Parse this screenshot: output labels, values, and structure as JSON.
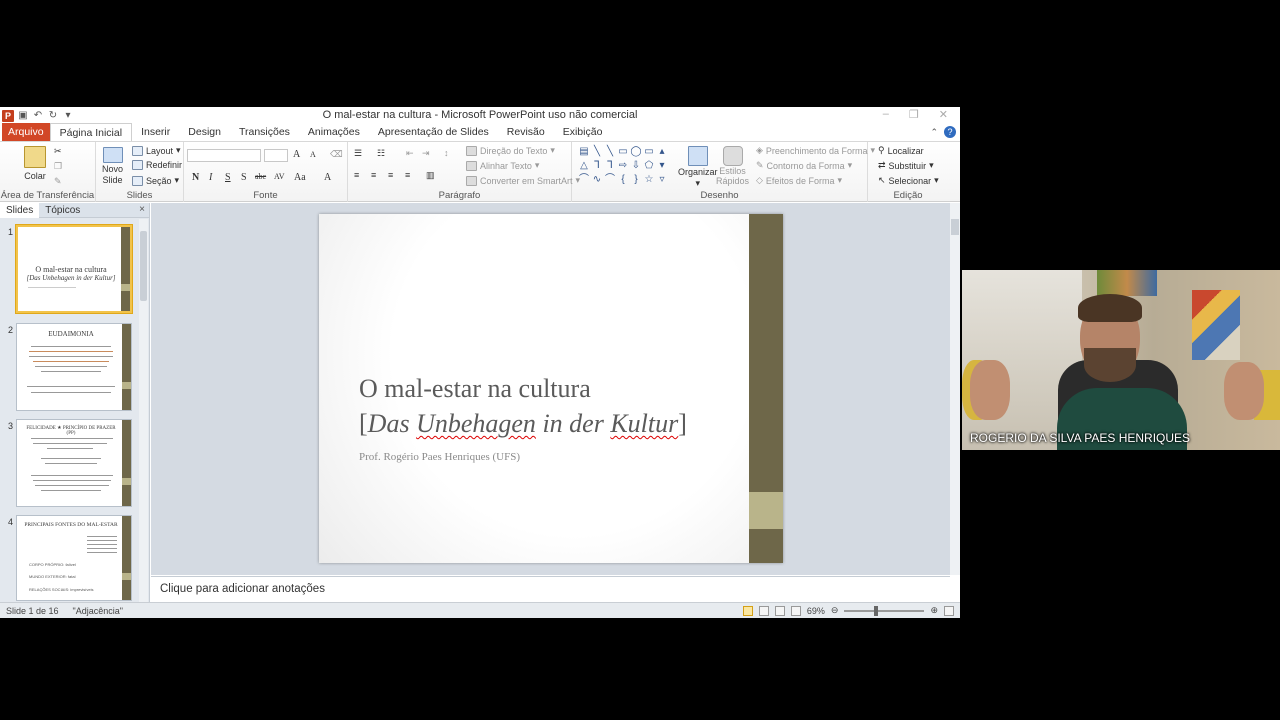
{
  "window": {
    "title": "O mal-estar na cultura  -  Microsoft PowerPoint uso não comercial",
    "logo": "P"
  },
  "tabs": [
    {
      "label": "Arquivo"
    },
    {
      "label": "Página Inicial"
    },
    {
      "label": "Inserir"
    },
    {
      "label": "Design"
    },
    {
      "label": "Transições"
    },
    {
      "label": "Animações"
    },
    {
      "label": "Apresentação de Slides"
    },
    {
      "label": "Revisão"
    },
    {
      "label": "Exibição"
    }
  ],
  "ribbon": {
    "clipboard": {
      "paste": "Colar",
      "label": "Área de Transferência"
    },
    "slides": {
      "new_slide_1": "Novo",
      "new_slide_2": "Slide",
      "layout": "Layout",
      "reset": "Redefinir",
      "section": "Seção",
      "label": "Slides"
    },
    "font": {
      "label": "Fonte",
      "bold": "N",
      "italic": "I",
      "underline": "S",
      "shadow": "S",
      "strike": "abc",
      "spacing": "AV",
      "case": "Aa",
      "color": "A",
      "grow": "A",
      "shrink": "A"
    },
    "paragraph": {
      "label": "Parágrafo",
      "direction": "Direção do Texto",
      "align_text": "Alinhar Texto",
      "smartart": "Converter em SmartArt"
    },
    "drawing": {
      "label": "Desenho",
      "arrange": "Organizar",
      "quick_styles_1": "Estilos",
      "quick_styles_2": "Rápidos",
      "fill": "Preenchimento da Forma",
      "outline": "Contorno da Forma",
      "effects": "Efeitos de Forma"
    },
    "editing": {
      "label": "Edição",
      "find": "Localizar",
      "replace": "Substituir",
      "select": "Selecionar"
    }
  },
  "left_pane": {
    "tabs": [
      "Slides",
      "Tópicos"
    ],
    "close": "×",
    "thumbnails": [
      {
        "num": "1",
        "title1": "O mal-estar na cultura",
        "title2": "[Das Unbehagen in der Kultur]"
      },
      {
        "num": "2",
        "title1": "EUDAIMONIA"
      },
      {
        "num": "3",
        "title1": "FELICIDADE ★ PRINCÍPIO DE PRAZER (PP)"
      },
      {
        "num": "4",
        "title1": "PRINCIPAIS FONTES DO MAL-ESTAR",
        "lines": [
          "CORPO PRÓPRIO: falível",
          "MUNDO EXTERIOR: fatal",
          "RELAÇÕES SOCIAIS: imprevisíveis"
        ]
      }
    ]
  },
  "slide": {
    "title_line1": "O mal-estar na cultura",
    "title_line2_open": "[",
    "title_w1": "Das",
    "title_w2": "Unbehagen",
    "title_w3": "in der",
    "title_w4": "Kultur",
    "title_line2_close": "]",
    "subtitle": "Prof. Rogério Paes Henriques  (UFS)"
  },
  "notes": {
    "placeholder": "Clique para adicionar anotações"
  },
  "status": {
    "slide_info": "Slide 1 de 16",
    "theme": "\"Adjacência\"",
    "zoom": "69%"
  },
  "video": {
    "participant_name": "ROGERIO DA SILVA PAES HENRIQUES"
  }
}
